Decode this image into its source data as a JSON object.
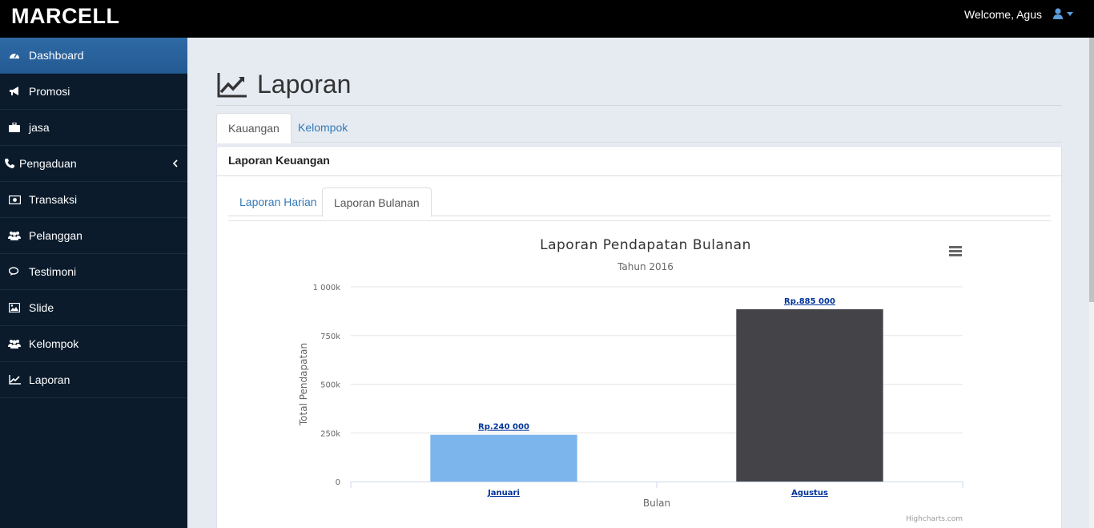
{
  "app": {
    "brand": "MARCELL",
    "welcome": "Welcome, Agus"
  },
  "sidebar": {
    "items": [
      {
        "label": "Dashboard",
        "icon": "dashboard-icon",
        "active": true
      },
      {
        "label": "Promosi",
        "icon": "bullhorn-icon"
      },
      {
        "label": "jasa",
        "icon": "briefcase-icon"
      },
      {
        "label": "Pengaduan",
        "icon": "phone-icon",
        "has_submenu": true
      },
      {
        "label": "Transaksi",
        "icon": "money-icon"
      },
      {
        "label": "Pelanggan",
        "icon": "users-icon"
      },
      {
        "label": "Testimoni",
        "icon": "comments-icon"
      },
      {
        "label": "Slide",
        "icon": "image-icon"
      },
      {
        "label": "Kelompok",
        "icon": "users-icon"
      },
      {
        "label": "Laporan",
        "icon": "line-chart-icon"
      }
    ]
  },
  "page": {
    "title": "Laporan",
    "tabs": [
      {
        "label": "Kauangan",
        "active": true
      },
      {
        "label": "Kelompok"
      }
    ],
    "panel_title": "Laporan Keuangan",
    "subtabs": [
      {
        "label": "Laporan Harian"
      },
      {
        "label": "Laporan Bulanan",
        "active": true
      }
    ]
  },
  "chart_data": {
    "type": "bar",
    "title": "Laporan Pendapatan Bulanan",
    "subtitle": "Tahun 2016",
    "xlabel": "Bulan",
    "ylabel": "Total Pendapatan",
    "categories": [
      "Januari",
      "Agustus"
    ],
    "values": [
      240000,
      885000
    ],
    "data_labels": [
      "Rp.240 000",
      "Rp.885 000"
    ],
    "colors": [
      "#7cb5ec",
      "#434348"
    ],
    "ylim": [
      0,
      1000000
    ],
    "yticks": [
      0,
      250000,
      500000,
      750000,
      1000000
    ],
    "ytick_labels": [
      "0",
      "250k",
      "500k",
      "750k",
      "1 000k"
    ],
    "grid": true,
    "credits": "Highcharts.com"
  },
  "colors": {
    "topbar": "#000000",
    "sidebar": "#0b1b2c",
    "active": "#2e6aa6",
    "link": "#337ab7"
  }
}
